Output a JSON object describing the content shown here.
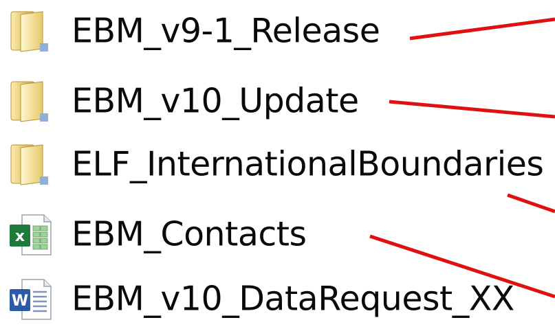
{
  "files": [
    {
      "name": "EBM_v9-1_Release",
      "icon": "folder-icon"
    },
    {
      "name": "EBM_v10_Update",
      "icon": "folder-icon"
    },
    {
      "name": "ELF_InternationalBoundaries",
      "icon": "folder-icon"
    },
    {
      "name": "EBM_Contacts",
      "icon": "excel-file-icon"
    },
    {
      "name": "EBM_v10_DataRequest_XX",
      "icon": "word-file-icon"
    }
  ],
  "colors": {
    "annotation_line": "#e01010",
    "folder_light": "#f6e3a0",
    "folder_dark": "#c9a742",
    "excel_green": "#1f7a3a",
    "word_blue": "#2a5aa8"
  }
}
